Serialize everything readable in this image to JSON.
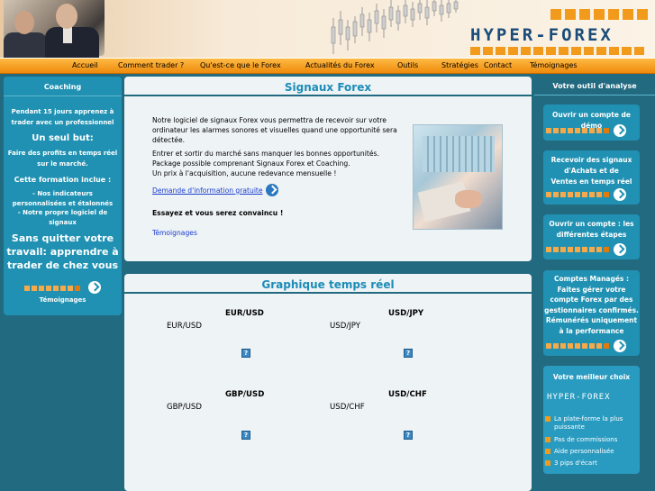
{
  "header": {
    "logo_text": "HYPER-FOREX"
  },
  "nav": [
    "Accueil",
    "Comment trader ?",
    "Qu'est-ce que le Forex",
    "Actualités du Forex",
    "Outils",
    "Stratégies",
    "Contact",
    "Témoignages"
  ],
  "left": {
    "title": "Coaching",
    "p1": "Pendant 15 jours apprenez à trader avec un professionnel",
    "h1": "Un seul but:",
    "p2": "Faire des profits en temps réel sur le marché.",
    "h2": "Cette formation inclue :",
    "li1": "- Nos indicateurs personnalisées et étalonnés",
    "li2": "- Notre propre logiciel de signaux",
    "big": "Sans quitter votre travail: apprendre à trader de chez vous",
    "link": "Témoignages"
  },
  "signals": {
    "title": "Signaux Forex",
    "p1": "Notre logiciel de signaux Forex vous permettra de recevoir sur votre ordinateur les alarmes sonores et visuelles quand une opportunité sera détectée.",
    "p2": "Entrer et sortir du marché sans manquer les bonnes opportunités.",
    "p3": "Package possible comprenant Signaux Forex et Coaching.",
    "p4": "Un prix à l'acquisition, aucune redevance mensuelle !",
    "link": "Demande d'information gratuite",
    "bold": "Essayez et vous serez convaincu !",
    "temo": "Témoignages"
  },
  "graph": {
    "title": "Graphique temps réel",
    "pairs": [
      {
        "head": "EUR/USD",
        "sub": "EUR/USD"
      },
      {
        "head": "USD/JPY",
        "sub": "USD/JPY"
      },
      {
        "head": "GBP/USD",
        "sub": "GBP/USD"
      },
      {
        "head": "USD/CHF",
        "sub": "USD/CHF"
      }
    ],
    "qm": "?"
  },
  "right": {
    "title": "Votre outil d'analyse",
    "b1": "Ouvrir un compte de démo",
    "b2": "Recevoir des signaux d'Achats et de Ventes en temps réel",
    "b3": "Ouvrir un compte : les différentes étapes",
    "b4": "Comptes Managés : Faites gérer votre compte Forex par des gestionnaires confirmés. Rémunérés uniquement à la performance",
    "best": {
      "title": "Votre meilleur choix",
      "logo": "HYPER-FOREX",
      "items": [
        "La plate-forme la plus puissante",
        "Pas de commissions",
        "Aide personnalisée",
        "3 pips d'écart"
      ]
    }
  }
}
